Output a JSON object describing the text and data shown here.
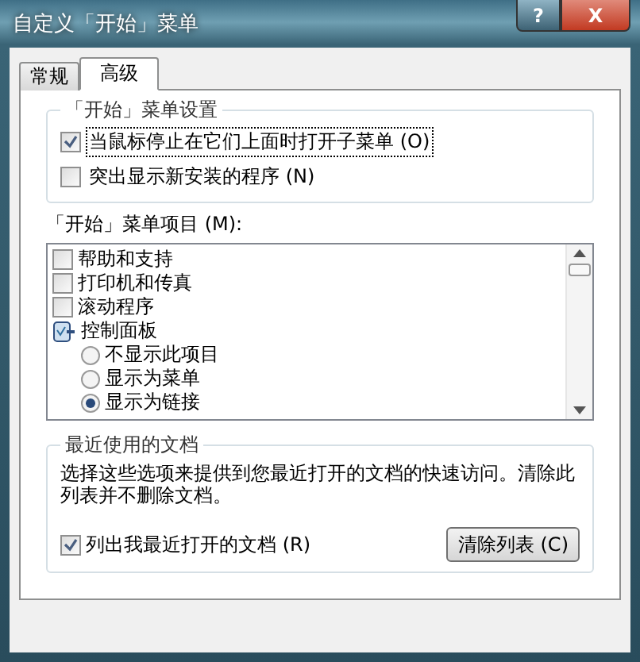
{
  "window": {
    "title": "自定义「开始」菜单",
    "buttons": [
      {
        "kind": "help",
        "label": "?"
      },
      {
        "kind": "close",
        "label": "X"
      }
    ]
  },
  "tabs": [
    {
      "label": "常规",
      "selected": false
    },
    {
      "label": "高级",
      "selected": true
    }
  ],
  "start_menu_settings": {
    "title": "「开始」菜单设置",
    "options": [
      {
        "label": "当鼠标停止在它们上面时打开子菜单 (O)",
        "checked": true,
        "focused": true
      },
      {
        "label": "突出显示新安装的程序 (N)",
        "checked": false,
        "focused": false
      }
    ]
  },
  "start_menu_items": {
    "label": "「开始」菜单项目 (M):",
    "items": [
      {
        "kind": "checkbox",
        "label": "帮助和支持",
        "checked": false
      },
      {
        "kind": "checkbox",
        "label": "打印机和传真",
        "checked": false
      },
      {
        "kind": "checkbox",
        "label": "滚动程序",
        "checked": false
      },
      {
        "kind": "group",
        "label": "控制面板",
        "children": [
          {
            "kind": "radio",
            "label": "不显示此项目",
            "selected": false
          },
          {
            "kind": "radio",
            "label": "显示为菜单",
            "selected": false
          },
          {
            "kind": "radio",
            "label": "显示为链接",
            "selected": true
          }
        ]
      }
    ]
  },
  "recent_documents": {
    "title": "最近使用的文档",
    "description": "选择这些选项来提供到您最近打开的文档的快速访问。清除此列表并不删除文档。",
    "option": {
      "label": "列出我最近打开的文档 (R)",
      "checked": true
    },
    "clear_button": "清除列表 (C)"
  }
}
